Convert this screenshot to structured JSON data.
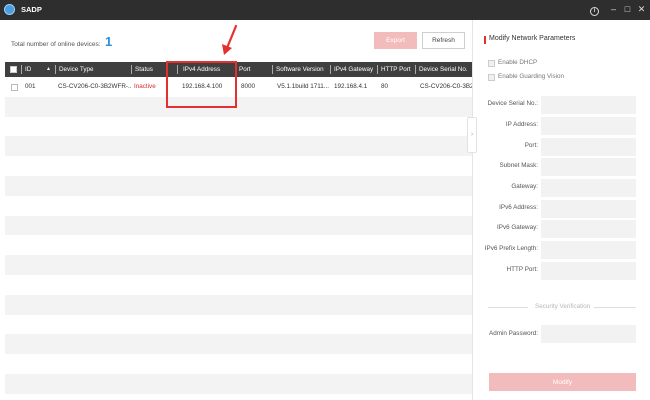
{
  "app": {
    "title": "SADP"
  },
  "window_controls": {
    "info": "i",
    "minimize": "–",
    "maximize": "□",
    "close": "✕"
  },
  "summary": {
    "online_label": "Total number of online devices:",
    "online_count": "1"
  },
  "toolbar": {
    "export_label": "Export",
    "refresh_label": "Refresh"
  },
  "table": {
    "headers": [
      "ID",
      "Device Type",
      "Status",
      "IPv4 Address",
      "Port",
      "Software Version",
      "IPv4 Gateway",
      "HTTP Port",
      "Device Serial No."
    ],
    "sort_indicator": "▲",
    "rows": [
      {
        "id": "001",
        "device_type": "CS-CV206-C0-3B2WFR-...",
        "status": "Inactive",
        "ipv4": "192.168.4.100",
        "port": "8000",
        "software_version": "V5.1.1build 1711...",
        "gateway": "192.168.4.1",
        "http_port": "80",
        "serial": "CS-CV206-C0-3B2W"
      }
    ]
  },
  "panel": {
    "title": "Modify Network Parameters",
    "enable_dhcp": "Enable DHCP",
    "enable_guarding": "Enable Guarding Vision",
    "labels": {
      "serial": "Device Serial No.:",
      "ip": "IP Address:",
      "port": "Port:",
      "mask": "Subnet Mask:",
      "gateway": "Gateway:",
      "ipv6": "IPv6 Address:",
      "ipv6_gateway": "IPv6 Gateway:",
      "ipv6_prefix": "IPv6 Prefix Length:",
      "http_port": "HTTP Port:"
    },
    "security_title": "Security Verification",
    "admin_password_label": "Admin Password:",
    "modify_label": "Modify",
    "collapse_glyph": "›"
  },
  "colors": {
    "accent_red": "#e53030",
    "count_blue": "#2a8fd8",
    "disabled_button": "#f3bcbc",
    "titlebar": "#2e2e2e",
    "table_header": "#3f3f3f"
  },
  "icons": {
    "app": "sadp-logo-icon",
    "annotation": "red-arrow-icon"
  }
}
